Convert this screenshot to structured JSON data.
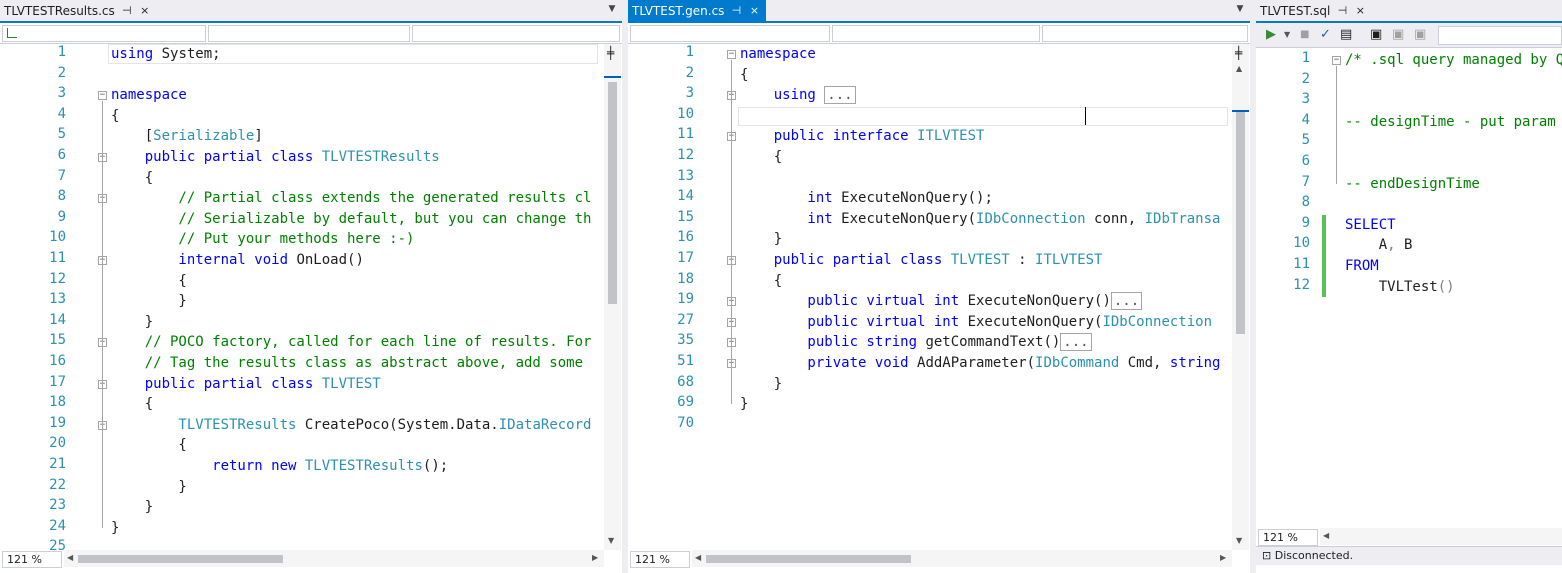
{
  "pane1": {
    "tab": {
      "label": "TLVTESTResults.cs",
      "pin": "⊣",
      "close": "×"
    },
    "zoom": "121 %",
    "lines": [
      {
        "n": "1",
        "t": [
          [
            "kw",
            "using"
          ],
          [
            "tx",
            " System;"
          ]
        ]
      },
      {
        "n": "2",
        "t": []
      },
      {
        "n": "3",
        "t": [
          [
            "kw",
            "namespace"
          ]
        ]
      },
      {
        "n": "4",
        "t": [
          [
            "tx",
            "{"
          ]
        ]
      },
      {
        "n": "5",
        "t": [
          [
            "tx",
            "    ["
          ],
          [
            "ty",
            "Serializable"
          ],
          [
            "tx",
            "]"
          ]
        ]
      },
      {
        "n": "6",
        "t": [
          [
            "kw",
            "    public partial class "
          ],
          [
            "ty",
            "TLVTESTResults"
          ]
        ]
      },
      {
        "n": "7",
        "t": [
          [
            "tx",
            "    {"
          ]
        ]
      },
      {
        "n": "8",
        "t": [
          [
            "cm",
            "        // Partial class extends the generated results cl"
          ]
        ]
      },
      {
        "n": "9",
        "t": [
          [
            "cm",
            "        // Serializable by default, but you can change th"
          ]
        ]
      },
      {
        "n": "10",
        "t": [
          [
            "cm",
            "        // Put your methods here :-)"
          ]
        ]
      },
      {
        "n": "11",
        "t": [
          [
            "kw",
            "        internal void "
          ],
          [
            "tx",
            "OnLoad()"
          ]
        ]
      },
      {
        "n": "12",
        "t": [
          [
            "tx",
            "        {"
          ]
        ]
      },
      {
        "n": "13",
        "t": [
          [
            "tx",
            "        }"
          ]
        ]
      },
      {
        "n": "14",
        "t": [
          [
            "tx",
            "    }"
          ]
        ]
      },
      {
        "n": "15",
        "t": [
          [
            "cm",
            "    // POCO factory, called for each line of results. For"
          ]
        ]
      },
      {
        "n": "16",
        "t": [
          [
            "cm",
            "    // Tag the results class as abstract above, add some"
          ]
        ]
      },
      {
        "n": "17",
        "t": [
          [
            "kw",
            "    public partial class "
          ],
          [
            "ty",
            "TLVTEST"
          ]
        ]
      },
      {
        "n": "18",
        "t": [
          [
            "tx",
            "    {"
          ]
        ]
      },
      {
        "n": "19",
        "t": [
          [
            "ty",
            "        TLVTESTResults "
          ],
          [
            "tx",
            "CreatePoco(System.Data."
          ],
          [
            "ty",
            "IDataRecord"
          ]
        ]
      },
      {
        "n": "20",
        "t": [
          [
            "tx",
            "        {"
          ]
        ]
      },
      {
        "n": "21",
        "t": [
          [
            "kw",
            "            return new "
          ],
          [
            "ty",
            "TLVTESTResults"
          ],
          [
            "tx",
            "();"
          ]
        ]
      },
      {
        "n": "22",
        "t": [
          [
            "tx",
            "        }"
          ]
        ]
      },
      {
        "n": "23",
        "t": [
          [
            "tx",
            "    }"
          ]
        ]
      },
      {
        "n": "24",
        "t": [
          [
            "tx",
            "}"
          ]
        ]
      },
      {
        "n": "25",
        "t": []
      }
    ]
  },
  "pane2": {
    "tab": {
      "label": "TLVTEST.gen.cs",
      "pin": "⊣",
      "close": "×"
    },
    "zoom": "121 %",
    "lines": [
      {
        "n": "1",
        "t": [
          [
            "kw",
            "namespace"
          ]
        ]
      },
      {
        "n": "2",
        "t": [
          [
            "tx",
            "{"
          ]
        ]
      },
      {
        "n": "3",
        "t": [
          [
            "kw",
            "    using "
          ],
          [
            "box",
            "..."
          ]
        ]
      },
      {
        "n": "10",
        "t": []
      },
      {
        "n": "11",
        "t": [
          [
            "kw",
            "    public interface "
          ],
          [
            "ty",
            "ITLVTEST"
          ]
        ]
      },
      {
        "n": "12",
        "t": [
          [
            "tx",
            "    {"
          ]
        ]
      },
      {
        "n": "13",
        "t": []
      },
      {
        "n": "14",
        "t": [
          [
            "kw",
            "        int "
          ],
          [
            "tx",
            "ExecuteNonQuery();"
          ]
        ]
      },
      {
        "n": "15",
        "t": [
          [
            "kw",
            "        int "
          ],
          [
            "tx",
            "ExecuteNonQuery("
          ],
          [
            "ty",
            "IDbConnection "
          ],
          [
            "tx",
            "conn, "
          ],
          [
            "ty",
            "IDbTransa"
          ]
        ]
      },
      {
        "n": "16",
        "t": [
          [
            "tx",
            "    }"
          ]
        ]
      },
      {
        "n": "17",
        "t": [
          [
            "kw",
            "    public partial class "
          ],
          [
            "ty",
            "TLVTEST "
          ],
          [
            "tx",
            ": "
          ],
          [
            "ty",
            "ITLVTEST"
          ]
        ]
      },
      {
        "n": "18",
        "t": [
          [
            "tx",
            "    {"
          ]
        ]
      },
      {
        "n": "19",
        "t": [
          [
            "kw",
            "        public virtual int "
          ],
          [
            "tx",
            "ExecuteNonQuery()"
          ],
          [
            "box",
            "..."
          ]
        ]
      },
      {
        "n": "27",
        "t": [
          [
            "kw",
            "        public virtual int "
          ],
          [
            "tx",
            "ExecuteNonQuery("
          ],
          [
            "ty",
            "IDbConnection"
          ]
        ]
      },
      {
        "n": "35",
        "t": [
          [
            "kw",
            "        public string "
          ],
          [
            "tx",
            "getCommandText()"
          ],
          [
            "box",
            "..."
          ]
        ]
      },
      {
        "n": "51",
        "t": [
          [
            "kw",
            "        private void "
          ],
          [
            "tx",
            "AddAParameter("
          ],
          [
            "ty",
            "IDbCommand "
          ],
          [
            "tx",
            "Cmd, "
          ],
          [
            "kw",
            "string"
          ]
        ]
      },
      {
        "n": "68",
        "t": [
          [
            "tx",
            "    }"
          ]
        ]
      },
      {
        "n": "69",
        "t": [
          [
            "tx",
            "}"
          ]
        ]
      },
      {
        "n": "70",
        "t": []
      }
    ]
  },
  "pane3": {
    "tab": {
      "label": "TLVTEST.sql",
      "pin": "⊣",
      "close": "×"
    },
    "zoom": "121 %",
    "status": "Disconnected.",
    "lines": [
      {
        "n": "1",
        "t": [
          [
            "cm",
            "/* .sql query managed by Q"
          ]
        ]
      },
      {
        "n": "2",
        "t": []
      },
      {
        "n": "3",
        "t": []
      },
      {
        "n": "4",
        "t": [
          [
            "cm",
            "-- designTime - put param"
          ]
        ]
      },
      {
        "n": "5",
        "t": []
      },
      {
        "n": "6",
        "t": []
      },
      {
        "n": "7",
        "t": [
          [
            "cm",
            "-- endDesignTime"
          ]
        ]
      },
      {
        "n": "8",
        "t": []
      },
      {
        "n": "9",
        "t": [
          [
            "kw",
            "SELECT"
          ]
        ]
      },
      {
        "n": "10",
        "t": [
          [
            "tx",
            "    A"
          ],
          [
            "gy",
            ","
          ],
          [
            "tx",
            " B"
          ]
        ]
      },
      {
        "n": "11",
        "t": [
          [
            "kw",
            "FROM"
          ]
        ]
      },
      {
        "n": "12",
        "t": [
          [
            "tx",
            "    TVLTest"
          ],
          [
            "gy",
            "()"
          ]
        ]
      }
    ]
  }
}
